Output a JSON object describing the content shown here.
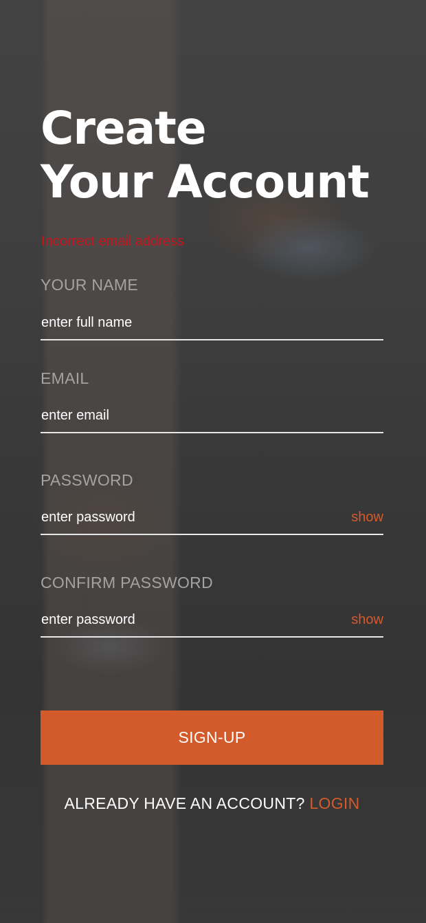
{
  "header": {
    "title_line1": "Create",
    "title_line2": "Your Account"
  },
  "error_message": "Incorrect email address",
  "form": {
    "name": {
      "label": "YOUR NAME",
      "placeholder": "enter full name",
      "value": ""
    },
    "email": {
      "label": "EMAIL",
      "placeholder": "enter email",
      "value": ""
    },
    "password": {
      "label": "PASSWORD",
      "placeholder": "enter password",
      "value": "",
      "toggle_label": "show"
    },
    "confirm_password": {
      "label": "CONFIRM PASSWORD",
      "placeholder": "enter password",
      "value": "",
      "toggle_label": "show"
    }
  },
  "actions": {
    "signup_label": "SIGN-UP",
    "login_prompt": "ALREADY HAVE AN ACCOUNT?",
    "login_label": "LOGIN"
  },
  "colors": {
    "accent": "#d35a2a",
    "error": "#c4161c",
    "label": "#a3a3a3",
    "text": "#ffffff"
  }
}
